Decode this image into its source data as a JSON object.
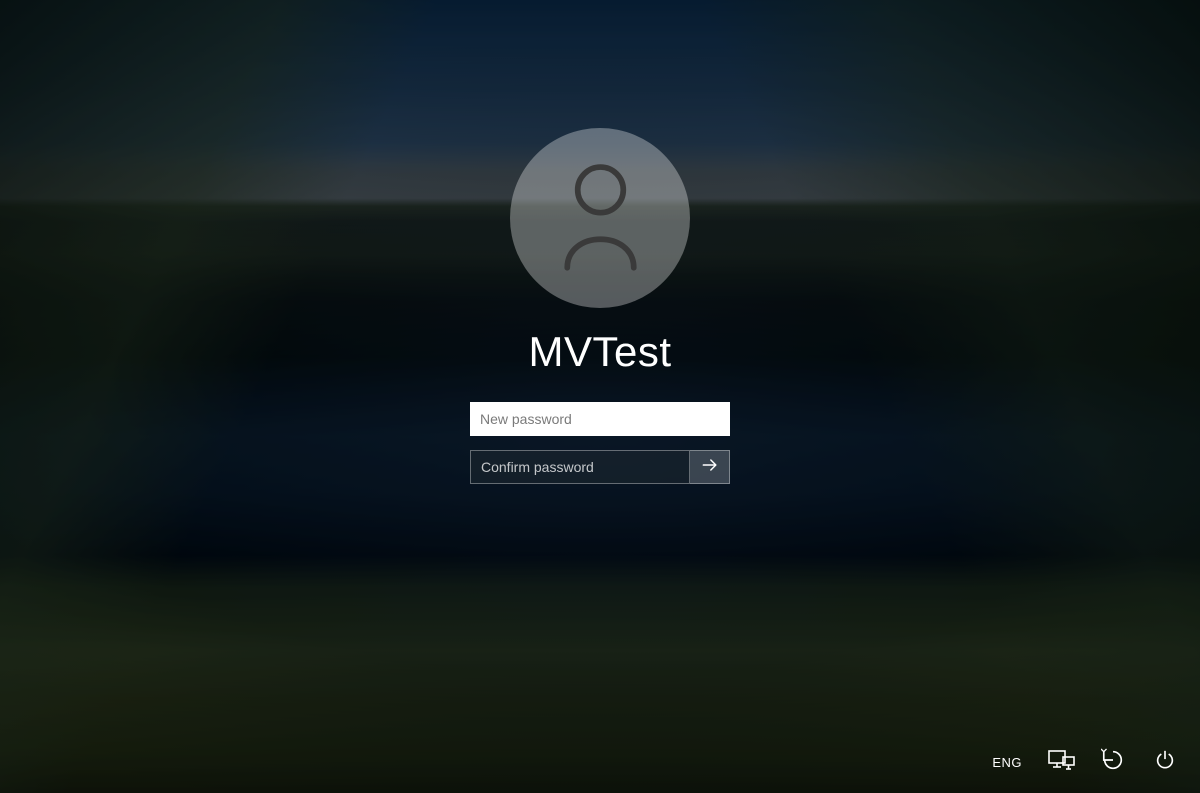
{
  "login": {
    "username": "MVTest",
    "new_password_placeholder": "New password",
    "new_password_value": "",
    "confirm_password_placeholder": "Confirm password",
    "confirm_password_value": ""
  },
  "tray": {
    "language": "ENG"
  }
}
